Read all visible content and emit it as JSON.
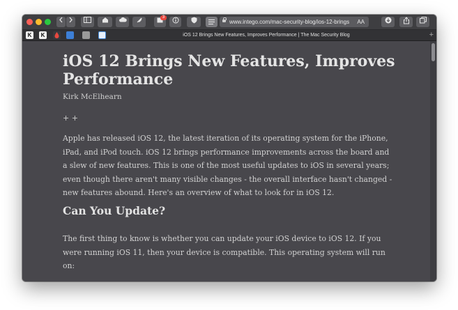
{
  "browser": {
    "address": {
      "url": "www.intego.com/mac-security-blog/ios-12-brings",
      "reader_label": "AA"
    },
    "toolbar": {
      "badge_count": "3"
    },
    "tab": {
      "title": "iOS 12 Brings New Features, Improves Performance | The Mac Security Blog",
      "new_tab_label": "+"
    },
    "bookmarks": [
      {
        "name": "K",
        "color": "#f2f2f2"
      },
      {
        "name": "K",
        "color": "#f2f2f2"
      },
      {
        "name": "drop-icon",
        "color": "#e8483f"
      },
      {
        "name": "blue-square-icon",
        "color": "#3d7fd6"
      },
      {
        "name": "gray-square-icon",
        "color": "#9a9a9a"
      },
      {
        "name": "blue-outline-icon",
        "color": "#4a90e2"
      }
    ]
  },
  "article": {
    "title": "iOS 12 Brings New Features, Improves Performance",
    "author": "Kirk McElhearn",
    "separator": "+ +",
    "intro": "Apple has released iOS 12, the latest iteration of its operating system for the iPhone, iPad, and iPod touch. iOS 12 brings performance improvements across the board and a slew of new features. This is one of the most useful updates to iOS in several years; even though there aren't many visible changes - the overall interface hasn't changed - new features abound. Here's an overview of what to look for in iOS 12.",
    "section_heading": "Can You Update?",
    "section_text": "The first thing to know is whether you can update your iOS device to iOS 12. If you were running iOS 11, then your device is compatible. This operating system will run on:"
  },
  "colors": {
    "reader_background": "#48474c",
    "text": "#d2d2d2",
    "close": "#fc5f57",
    "minimize": "#fdbc2e",
    "zoom": "#2bc840"
  }
}
